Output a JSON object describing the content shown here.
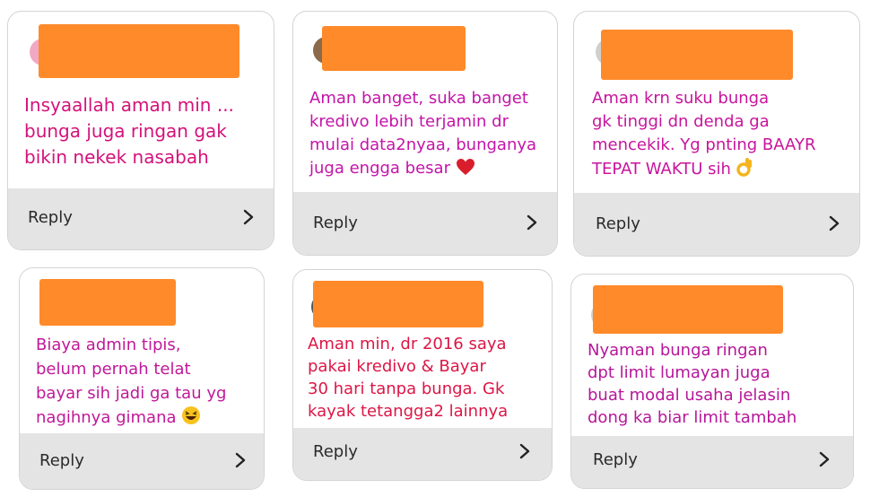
{
  "cards": [
    {
      "comment": "Insyaallah aman min ...\nbunga juga ringan gak\nbikin nekek nasabah",
      "text_color": "#d4127a",
      "emoji": "",
      "reply_label": "Reply"
    },
    {
      "comment": "Aman banget, suka banget\nkredivo lebih terjamin dr\nmulai data2nyaa, bunganya\njuga engga besar",
      "text_color": "#c414a8",
      "emoji": "heart-icon",
      "reply_label": "Reply"
    },
    {
      "comment": "Aman krn suku bunga\ngk tinggi dn denda ga\nmencekik. Yg pnting BAAYR\nTEPAT WAKTU sih",
      "text_color": "#c8149c",
      "emoji": "ok-hand-icon",
      "reply_label": "Reply"
    },
    {
      "comment": "Biaya admin tipis,\nbelum pernah telat\nbayar sih jadi ga tau yg\nnagihnya gimana",
      "text_color": "#c01898",
      "emoji": "laughing-face-icon",
      "reply_label": "Reply"
    },
    {
      "comment": "Aman min, dr 2016 saya\npakai kredivo & Bayar\n30 hari tanpa bunga. Gk\nkayak tetangga2 lainnya",
      "text_color": "#dc1646",
      "emoji": "",
      "reply_label": "Reply"
    },
    {
      "comment": "Nyaman bunga ringan\ndpt limit lumayan juga\nbuat modal usaha jelasin\ndong ka biar limit tambah",
      "text_color": "#b6169a",
      "emoji": "",
      "reply_label": "Reply"
    }
  ],
  "colors": {
    "redaction": "#ff8a2a",
    "footer_bg": "#e4e4e4",
    "card_border": "#d4d4d4"
  }
}
